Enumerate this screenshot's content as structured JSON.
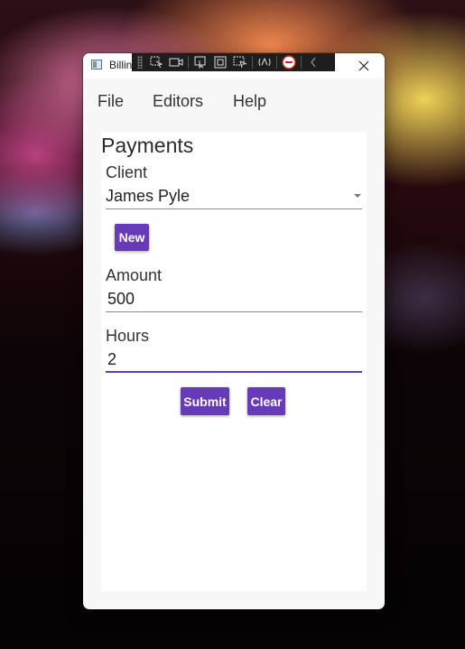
{
  "window": {
    "title": "Billing App"
  },
  "menu": [
    "File",
    "Editors",
    "Help"
  ],
  "form": {
    "heading": "Payments",
    "client_label": "Client",
    "client_value": "James Pyle",
    "new_label": "New",
    "amount_label": "Amount",
    "amount_value": "500",
    "hours_label": "Hours",
    "hours_value": "2",
    "submit_label": "Submit",
    "clear_label": "Clear"
  },
  "colors": {
    "accent": "#673ab7",
    "panel": "#ffffff",
    "window_bg": "#f7f7f7"
  },
  "debug_toolbar_icons": [
    "select-element-icon",
    "show-rendering-icon",
    "track-focus-icon",
    "layout-adorners-icon",
    "element-display-icon",
    "hot-reload-icon",
    "stop-icon",
    "collapse-icon"
  ]
}
